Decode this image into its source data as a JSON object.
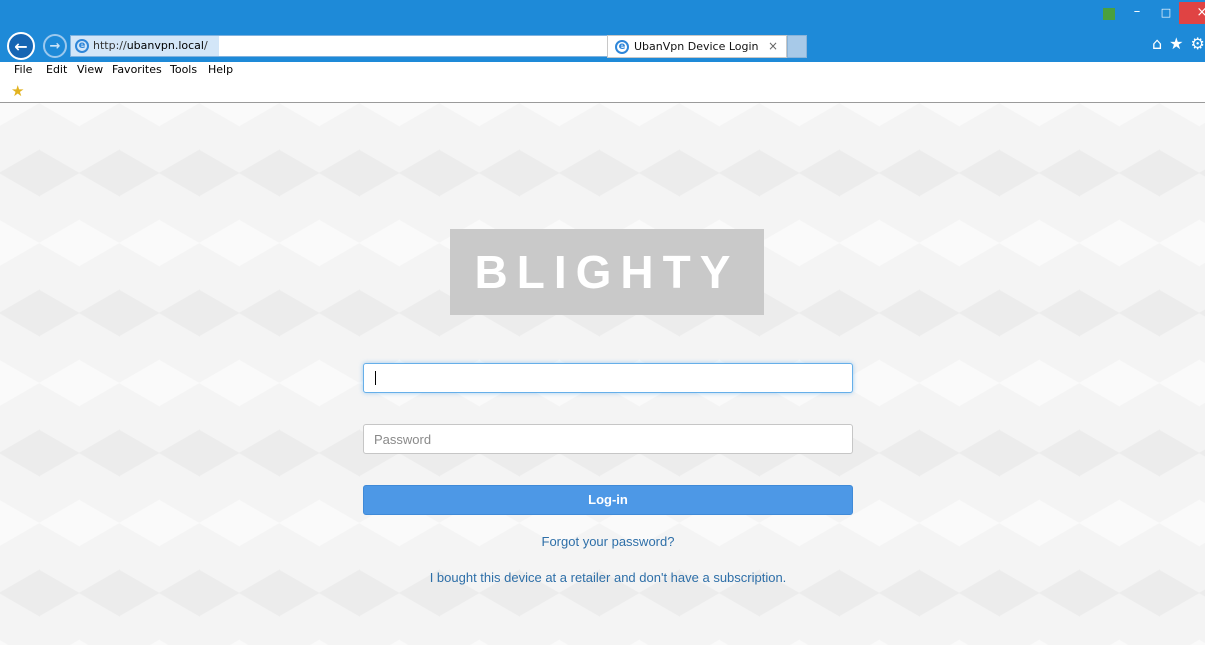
{
  "browser": {
    "url_prefix": "http://",
    "url_host": "ubanvpn.local",
    "url_suffix": "/",
    "address_tools": "⌕ ▾ ↻",
    "tab_title": "UbanVpn Device Login",
    "tab_close": "×",
    "back_glyph": "←",
    "forward_glyph": "→",
    "window_controls": {
      "minimize": "–",
      "maximize": "□",
      "close": "×"
    },
    "right_icons": {
      "home": "⌂",
      "favorites": "★",
      "settings": "⚙"
    },
    "accent_color": "#1e8ad8"
  },
  "menu": {
    "items": [
      "File",
      "Edit",
      "View",
      "Favorites",
      "Tools",
      "Help"
    ]
  },
  "favorites_bar": {
    "icon": "★"
  },
  "login": {
    "logo_text": "BLIGHTY",
    "username_value": "",
    "password_placeholder": "Password",
    "login_button": "Log-in",
    "forgot_link": "Forgot your password?",
    "retailer_link": "I bought this device at a retailer and don't have a subscription.",
    "button_color": "#4d98e6",
    "link_color": "#2e6fa8"
  }
}
